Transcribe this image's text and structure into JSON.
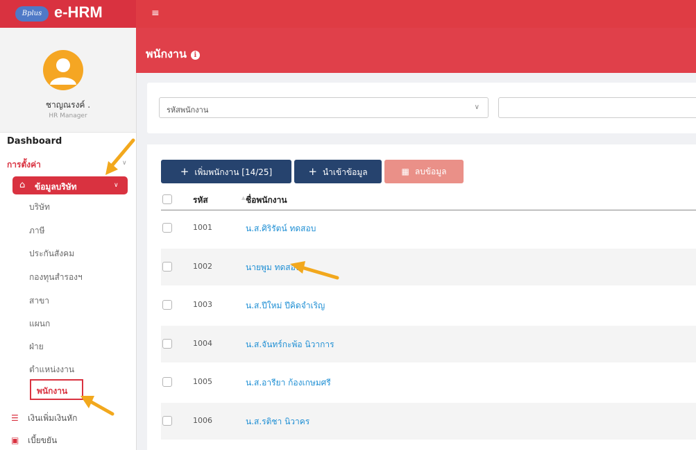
{
  "brand": {
    "badge": "Bplus",
    "name": "e-HRM"
  },
  "user": {
    "name": "ชาญณรงค์ .",
    "role": "HR Manager"
  },
  "nav": {
    "dashboard": "Dashboard",
    "settings": "การตั้งค่า",
    "company_group": "ข้อมูลบริษัท",
    "sub_items": [
      "บริษัท",
      "ภาษี",
      "ประกันสังคม",
      "กองทุนสำรองฯ",
      "สาขา",
      "แผนก",
      "ฝ่าย",
      "ตำแหน่งงาน"
    ],
    "active_sub": "พนักงาน",
    "bottom_items": [
      {
        "label": "เงินเพิ่มเงินหัก",
        "icon": "list-icon"
      },
      {
        "label": "เบี้ยขยัน",
        "icon": "money-icon"
      }
    ]
  },
  "page": {
    "title": "พนักงาน"
  },
  "filter": {
    "field_select": "รหัสพนักงาน"
  },
  "toolbar": {
    "add_label": "เพิ่มพนักงาน [14/25]",
    "import_label": "นำเข้าข้อมูล",
    "delete_label": "ลบข้อมูล"
  },
  "table": {
    "columns": [
      "รหัส",
      "ชื่อพนักงาน"
    ],
    "rows": [
      {
        "code": "1001",
        "name": "น.ส.ศิริรัตน์ ทดสอบ"
      },
      {
        "code": "1002",
        "name": "นายพูม ทดสอบ"
      },
      {
        "code": "1003",
        "name": "น.ส.ปีใหม่ ปีคิดจำเริญ"
      },
      {
        "code": "1004",
        "name": "น.ส.จันทร์กะพ้อ นิวาการ"
      },
      {
        "code": "1005",
        "name": "น.ส.อารียา ก้องเกษมศรี"
      },
      {
        "code": "1006",
        "name": "น.ส.รติชา นิวาคร"
      }
    ]
  },
  "colors": {
    "primary": "#df3c44",
    "navy": "#26436e",
    "link": "#1f8fd4",
    "arrow": "#f2a81d"
  }
}
